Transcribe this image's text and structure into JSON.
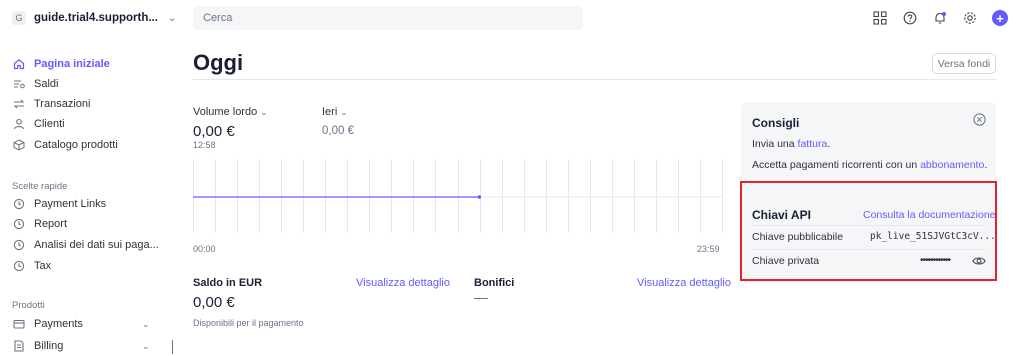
{
  "account": {
    "initial": "G",
    "name": "guide.trial4.supporth..."
  },
  "nav": {
    "home": "Pagina iniziale",
    "balances": "Saldi",
    "transactions": "Transazioni",
    "customers": "Clienti",
    "catalog": "Catalogo prodotti"
  },
  "shortcuts": {
    "label": "Scelte rapide",
    "items": [
      "Payment Links",
      "Report",
      "Analisi dei dati sui paga...",
      "Tax"
    ]
  },
  "products": {
    "label": "Prodotti",
    "items": [
      "Payments",
      "Billing"
    ]
  },
  "search": {
    "placeholder": "Cerca"
  },
  "page": {
    "title": "Oggi",
    "payout_button": "Versa fondi"
  },
  "metrics": {
    "gross_label": "Volume lordo",
    "gross_value": "0,00 €",
    "gross_time": "12:58",
    "compare_label": "Ieri",
    "compare_value": "0,00 €"
  },
  "chart_data": {
    "type": "line",
    "x_start": "00:00",
    "x_end": "23:59",
    "series": [
      {
        "values": [
          0,
          0
        ]
      }
    ],
    "current_time": "12:58",
    "grid": true,
    "colors": {
      "line": "#635bff",
      "grid": "#e3e8ee"
    }
  },
  "balance": {
    "label": "Saldo in EUR",
    "link": "Visualizza dettaglio",
    "value": "0,00 €",
    "sub": "Disponibili per il pagamento"
  },
  "transfers": {
    "label": "Bonifici",
    "link": "Visualizza dettaglio"
  },
  "tips": {
    "title": "Consigli",
    "line1_prefix": "Invia una ",
    "line1_link": "fattura",
    "line1_suffix": ".",
    "line2_prefix": "Accetta pagamenti ricorrenti con un ",
    "line2_link": "abbonamento",
    "line2_suffix": "."
  },
  "api": {
    "title": "Chiavi API",
    "doc_link": "Consulta la documentazione",
    "publishable_label": "Chiave pubblicabile",
    "publishable_value": "pk_live_51SJVGtC3cV...",
    "secret_label": "Chiave privata",
    "secret_value": "••••••••••••"
  },
  "colors": {
    "accent": "#635bff",
    "highlight": "#e5222a"
  }
}
